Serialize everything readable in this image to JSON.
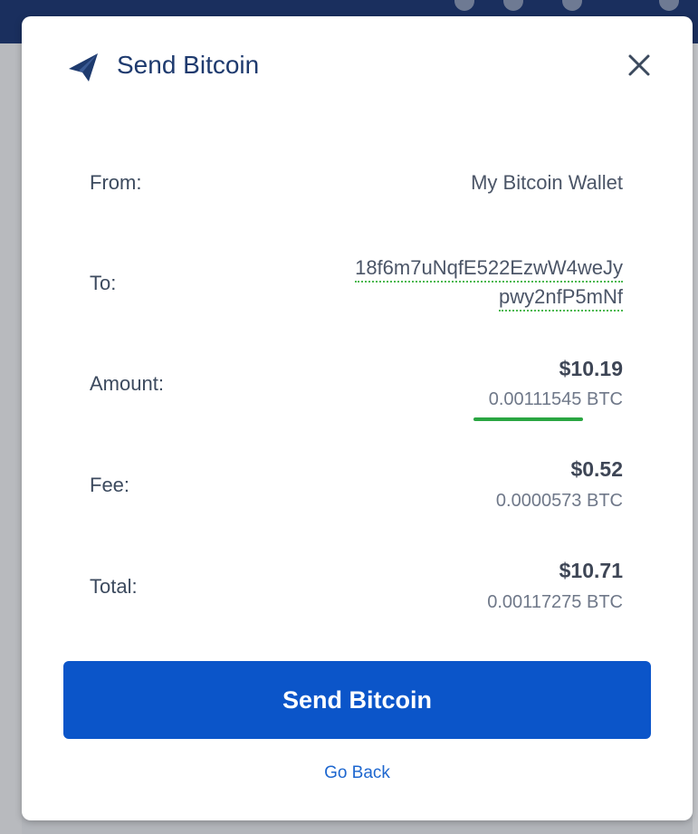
{
  "dialog": {
    "title": "Send Bitcoin",
    "icon": "paper-plane-icon",
    "close_icon": "close-icon"
  },
  "details": {
    "from": {
      "label": "From:",
      "value": "My Bitcoin Wallet"
    },
    "to": {
      "label": "To:",
      "address_line1": "18f6m7uNqfE522EzwW4weJy",
      "address_line2": "pwy2nfP5mNf"
    },
    "amount": {
      "label": "Amount:",
      "usd": "$10.19",
      "btc": "0.00111545 BTC"
    },
    "fee": {
      "label": "Fee:",
      "usd": "$0.52",
      "btc": "0.0000573 BTC"
    },
    "total": {
      "label": "Total:",
      "usd": "$10.71",
      "btc": "0.00117275 BTC"
    }
  },
  "actions": {
    "send_label": "Send Bitcoin",
    "back_label": "Go Back"
  },
  "colors": {
    "primary_button": "#0b55c9",
    "title": "#1e3a6e",
    "link": "#1e67cf",
    "accent_green": "#2aa642"
  }
}
